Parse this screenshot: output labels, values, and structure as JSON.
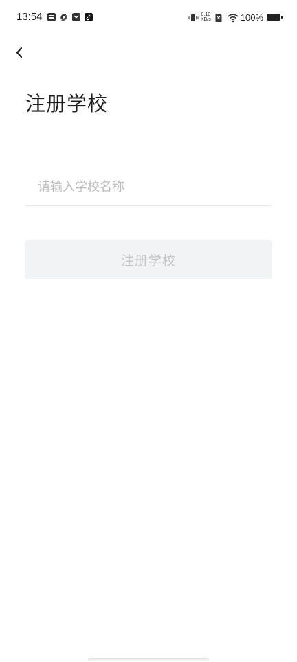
{
  "status_bar": {
    "time": "13:54",
    "net_speed_value": "0.10",
    "net_speed_unit": "KB/s",
    "battery_percent": "100%",
    "icons_left": [
      "app-notification-icon",
      "sync-app-icon",
      "message-icon",
      "tiktok-icon"
    ],
    "icons_right": [
      "vibrate-icon",
      "sim-icon",
      "wifi-icon",
      "battery-icon"
    ]
  },
  "header": {
    "back_icon": "chevron-left-icon"
  },
  "page": {
    "title": "注册学校"
  },
  "form": {
    "school_name": {
      "value": "",
      "placeholder": "请输入学校名称"
    },
    "submit_label": "注册学校"
  },
  "colors": {
    "background": "#ffffff",
    "title": "#1f1f1f",
    "placeholder": "#bcbcbc",
    "button_bg": "#f2f3f5",
    "button_text": "#c2c4c8"
  }
}
